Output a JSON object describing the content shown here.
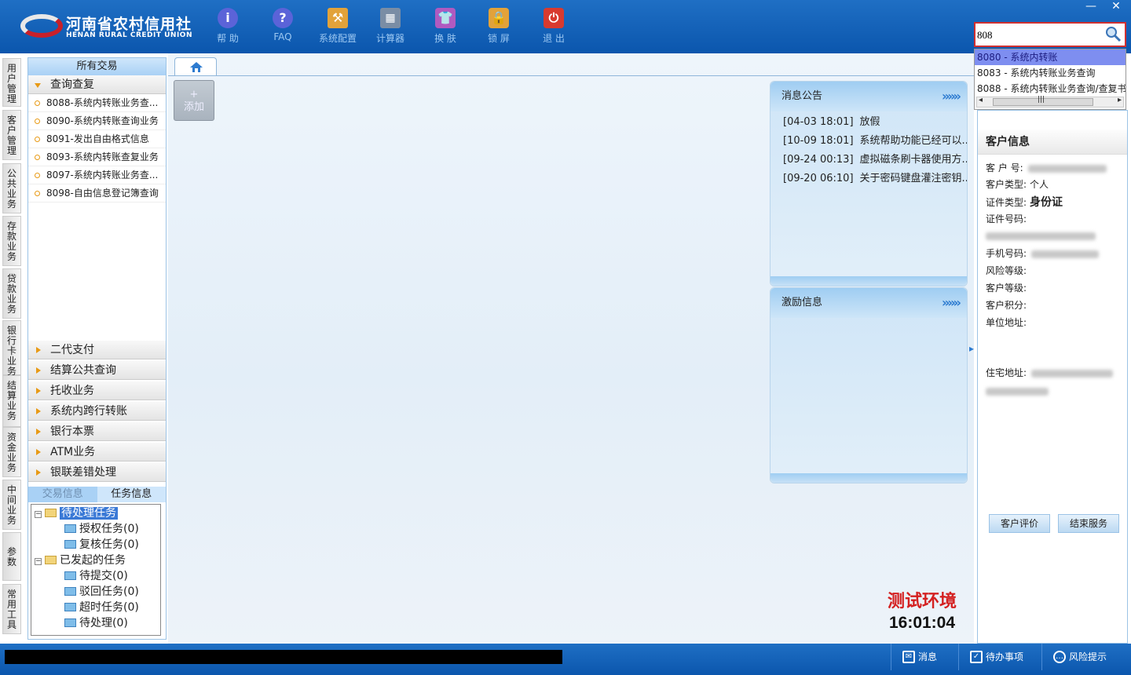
{
  "header": {
    "logo_cn": "河南省农村信用社",
    "logo_en": "HENAN RURAL CREDIT UNION",
    "tools": [
      {
        "label": "帮 助",
        "icon": "help-icon"
      },
      {
        "label": "FAQ",
        "icon": "faq-icon"
      },
      {
        "label": "系统配置",
        "icon": "toolbox-icon"
      },
      {
        "label": "计算器",
        "icon": "calculator-icon"
      },
      {
        "label": "换 肤",
        "icon": "shirt-icon"
      },
      {
        "label": "锁 屏",
        "icon": "lock-icon"
      },
      {
        "label": "退 出",
        "icon": "power-icon"
      }
    ],
    "window": {
      "minimize": "—",
      "close": "✕"
    }
  },
  "search": {
    "value": "808",
    "suggestions": [
      "8080 - 系统内转账",
      "8083 - 系统内转账业务查询",
      "8088 - 系统内转账业务查询/查复书"
    ],
    "scroll_grip": "|||"
  },
  "sidebar_tabs": [
    "用户管理",
    "客户管理",
    "公共业务",
    "存款业务",
    "贷款业务",
    "银行卡业务",
    "结算业务",
    "资金业务",
    "中间业务",
    "参数",
    "常用工具"
  ],
  "menu": {
    "title": "所有交易",
    "open_group": "查询查复",
    "items": [
      "8088-系统内转账业务查...",
      "8090-系统内转账查询业务",
      "8091-发出自由格式信息",
      "8093-系统内转账查复业务",
      "8097-系统内转账业务查...",
      "8098-自由信息登记簿查询"
    ],
    "groups": [
      "二代支付",
      "结算公共查询",
      "托收业务",
      "系统内跨行转账",
      "银行本票",
      "ATM业务",
      "银联差错处理"
    ],
    "bottom_tabs": [
      "交易信息",
      "任务信息"
    ]
  },
  "tree": {
    "pending": "待处理任务",
    "pending_children": [
      "授权任务(0)",
      "复核任务(0)"
    ],
    "initiated": "已发起的任务",
    "initiated_children": [
      "待提交(0)",
      "驳回任务(0)",
      "超时任务(0)",
      "待处理(0)"
    ],
    "expand_symbol": "−"
  },
  "main": {
    "add_label": "添加",
    "add_plus": "+"
  },
  "notice": {
    "title": "消息公告",
    "more": "»»»",
    "items": [
      {
        "time": "[04-03 18:01]",
        "text": "放假"
      },
      {
        "time": "[10-09 18:01]",
        "text": "系统帮助功能已经可以..."
      },
      {
        "time": "[09-24 00:13]",
        "text": "虚拟磁条刷卡器使用方..."
      },
      {
        "time": "[09-20 06:10]",
        "text": "关于密码键盘灌注密钥..."
      }
    ]
  },
  "incentive": {
    "title": "激励信息",
    "more": "»»»"
  },
  "env": {
    "label": "测试环境",
    "time": "16:01:04"
  },
  "customer": {
    "title": "客户信息",
    "fields": {
      "cust_no": "客 户 号:",
      "cust_type": "客户类型:",
      "cust_type_value": "个人",
      "id_type": "证件类型:",
      "id_type_value": "身份证",
      "id_no": "证件号码:",
      "phone": "手机号码:",
      "risk": "风险等级:",
      "level": "客户等级:",
      "points": "客户积分:",
      "unit_addr": "单位地址:",
      "home_addr": "住宅地址:"
    },
    "buttons": {
      "evaluate": "客户评价",
      "end": "结束服务"
    }
  },
  "status": {
    "message": "消息",
    "todo": "待办事项",
    "risk": "风险提示"
  }
}
